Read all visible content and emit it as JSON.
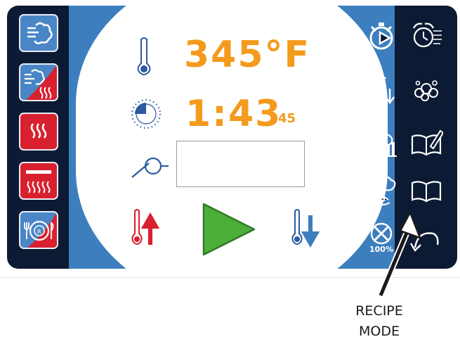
{
  "display": {
    "temperature": "345°F",
    "time_main": "1:43",
    "time_seconds": "45",
    "probe_value": ""
  },
  "left_modes": [
    {
      "name": "steam-mode",
      "icon": "steam-icon"
    },
    {
      "name": "combi-mode",
      "icon": "combi-steam-heat-icon"
    },
    {
      "name": "convection-mode",
      "icon": "convection-heat-icon"
    },
    {
      "name": "retherm-mode",
      "icon": "heat-element-icon"
    },
    {
      "name": "retherm-plate-mode",
      "icon": "plate-retherm-icon"
    }
  ],
  "right_icons": [
    "timer-play-icon",
    "alarm-clock-icon",
    "lightning-down-icon",
    "wash-cleaning-icon",
    "chicken-chart-icon",
    "recipe-edit-book-icon",
    "steam-pot-icon",
    "recipe-book-icon",
    "power-percent-icon",
    "back-arrow-icon"
  ],
  "power_label": "100%",
  "caption": {
    "line1": "RECIPE",
    "line2": "MODE"
  },
  "colors": {
    "panel": "#0c1a33",
    "accent_orange": "#f49a1c",
    "mode_blue": "#3d7fbe",
    "mode_red": "#d9202e",
    "start_green": "#4caf3a"
  }
}
